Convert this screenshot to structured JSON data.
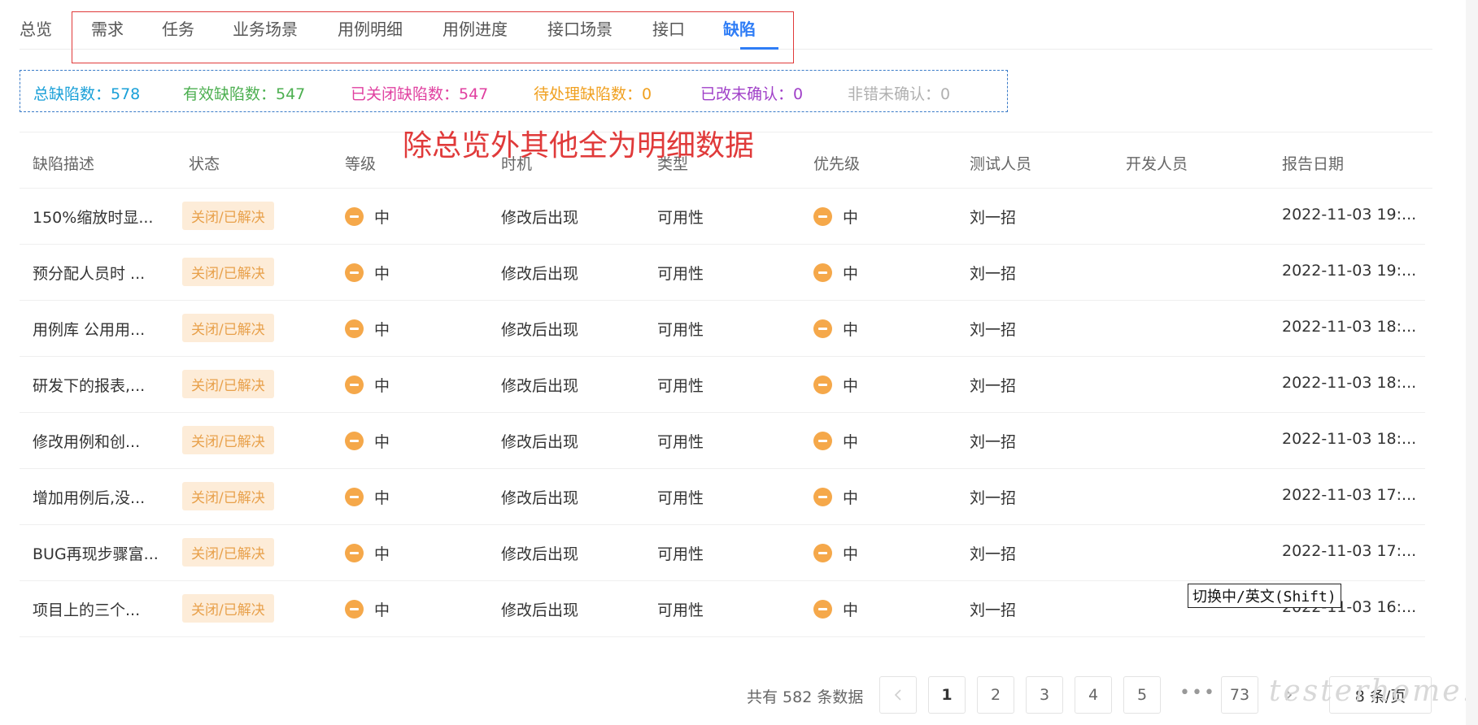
{
  "tabs": [
    {
      "label": "总览"
    },
    {
      "label": "需求"
    },
    {
      "label": "任务"
    },
    {
      "label": "业务场景"
    },
    {
      "label": "用例明细"
    },
    {
      "label": "用例进度"
    },
    {
      "label": "接口场景"
    },
    {
      "label": "接口"
    },
    {
      "label": "缺陷"
    }
  ],
  "active_tab": "缺陷",
  "summary": [
    {
      "label": "总缺陷数：578",
      "color": "#1aa0d8"
    },
    {
      "label": "有效缺陷数：547",
      "color": "#4caf50"
    },
    {
      "label": "已关闭缺陷数：547",
      "color": "#e040a0"
    },
    {
      "label": "待处理缺陷数：0",
      "color": "#f0a020"
    },
    {
      "label": "已改未确认：0",
      "color": "#a040c8"
    },
    {
      "label": "非错未确认：0",
      "color": "#b0b0b0"
    }
  ],
  "overlay_note": "除总览外其他全为明细数据",
  "table": {
    "columns": [
      "缺陷描述",
      "状态",
      "等级",
      "时机",
      "类型",
      "优先级",
      "测试人员",
      "开发人员",
      "报告日期"
    ],
    "rows": [
      {
        "desc": "150%缩放时显...",
        "status": "关闭/已解决",
        "level": "中",
        "timing": "修改后出现",
        "type": "可用性",
        "priority": "中",
        "tester": "刘一招",
        "developer": "",
        "date": "2022-11-03 19:..."
      },
      {
        "desc": "预分配人员时 ...",
        "status": "关闭/已解决",
        "level": "中",
        "timing": "修改后出现",
        "type": "可用性",
        "priority": "中",
        "tester": "刘一招",
        "developer": "",
        "date": "2022-11-03 19:..."
      },
      {
        "desc": "用例库 公用用...",
        "status": "关闭/已解决",
        "level": "中",
        "timing": "修改后出现",
        "type": "可用性",
        "priority": "中",
        "tester": "刘一招",
        "developer": "",
        "date": "2022-11-03 18:..."
      },
      {
        "desc": "研发下的报表,...",
        "status": "关闭/已解决",
        "level": "中",
        "timing": "修改后出现",
        "type": "可用性",
        "priority": "中",
        "tester": "刘一招",
        "developer": "",
        "date": "2022-11-03 18:..."
      },
      {
        "desc": "修改用例和创...",
        "status": "关闭/已解决",
        "level": "中",
        "timing": "修改后出现",
        "type": "可用性",
        "priority": "中",
        "tester": "刘一招",
        "developer": "",
        "date": "2022-11-03 18:..."
      },
      {
        "desc": "增加用例后,没...",
        "status": "关闭/已解决",
        "level": "中",
        "timing": "修改后出现",
        "type": "可用性",
        "priority": "中",
        "tester": "刘一招",
        "developer": "",
        "date": "2022-11-03 17:..."
      },
      {
        "desc": "BUG再现步骤富...",
        "status": "关闭/已解决",
        "level": "中",
        "timing": "修改后出现",
        "type": "可用性",
        "priority": "中",
        "tester": "刘一招",
        "developer": "",
        "date": "2022-11-03 17:..."
      },
      {
        "desc": "项目上的三个...",
        "status": "关闭/已解决",
        "level": "中",
        "timing": "修改后出现",
        "type": "可用性",
        "priority": "中",
        "tester": "刘一招",
        "developer": "",
        "date": "2022-11-03 16:..."
      }
    ]
  },
  "ime_tooltip": "切换中/英文(Shift)",
  "pagination": {
    "total_text": "共有 582 条数据",
    "prev_icon": "chevron-left-icon",
    "next_icon": "chevron-right-icon",
    "pages": [
      "1",
      "2",
      "3",
      "4",
      "5"
    ],
    "ellipsis": "•••",
    "last_page": "73",
    "current": "1",
    "page_size": "8 条/页"
  },
  "watermark": "testerhome.com"
}
